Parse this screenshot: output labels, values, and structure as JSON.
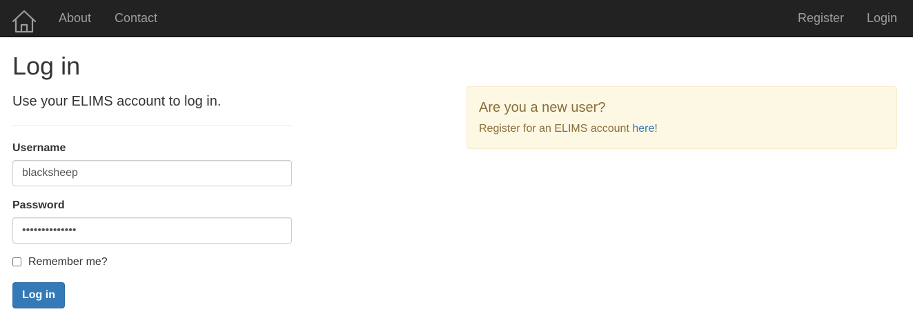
{
  "nav": {
    "home_icon": "home-icon",
    "left_links": [
      "About",
      "Contact"
    ],
    "right_links": [
      "Register",
      "Login"
    ]
  },
  "page": {
    "title": "Log in",
    "subtitle": "Use your ELIMS account to log in."
  },
  "form": {
    "username_label": "Username",
    "username_value": "blacksheep",
    "password_label": "Password",
    "password_value": "••••••••••••••",
    "remember_label": "Remember me?",
    "remember_checked": false,
    "submit_label": "Log in"
  },
  "register_panel": {
    "heading": "Are you a new user?",
    "text_before": "Register for an ELIMS account ",
    "link_text": "here",
    "text_after": "!"
  },
  "colors": {
    "navbar_bg": "#222222",
    "nav_link": "#9d9d9d",
    "primary": "#337ab7",
    "alert_bg": "#fcf8e3",
    "alert_border": "#faebcc",
    "alert_text": "#8a6d3b"
  }
}
